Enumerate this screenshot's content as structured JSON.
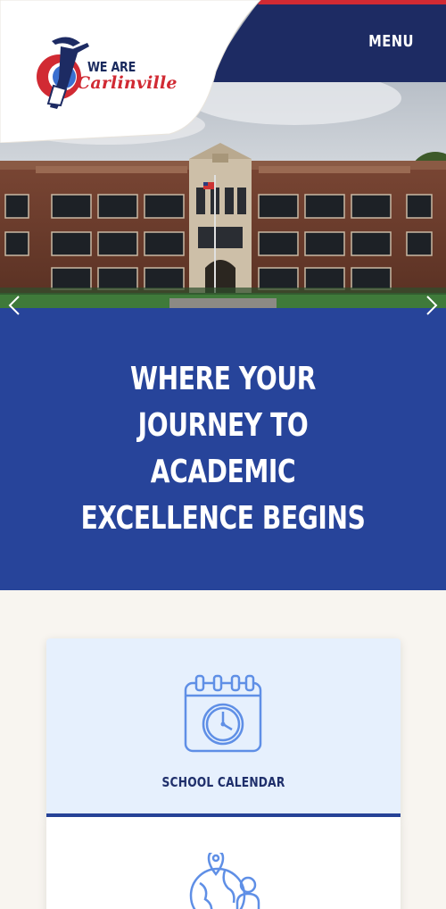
{
  "logo": {
    "line1": "WE ARE",
    "line2": "Carlinville"
  },
  "header": {
    "menu_label": "MENU"
  },
  "hero": {
    "prev_icon": "chevron-left-icon",
    "next_icon": "chevron-right-icon"
  },
  "tagline": {
    "text": "WHERE YOUR JOURNEY TO ACADEMIC EXCELLENCE BEGINS"
  },
  "quick_links": [
    {
      "label": "SCHOOL CALENDAR",
      "icon": "calendar-clock-icon"
    },
    {
      "label": "",
      "icon": "globe-person-icon"
    }
  ],
  "colors": {
    "brand_blue": "#27449a",
    "navy": "#1d2b63",
    "brand_red": "#d12a33",
    "icon_blue": "#5f8fe6",
    "card_bg": "#e6f0fd",
    "page_bg": "#f8f5f0"
  }
}
